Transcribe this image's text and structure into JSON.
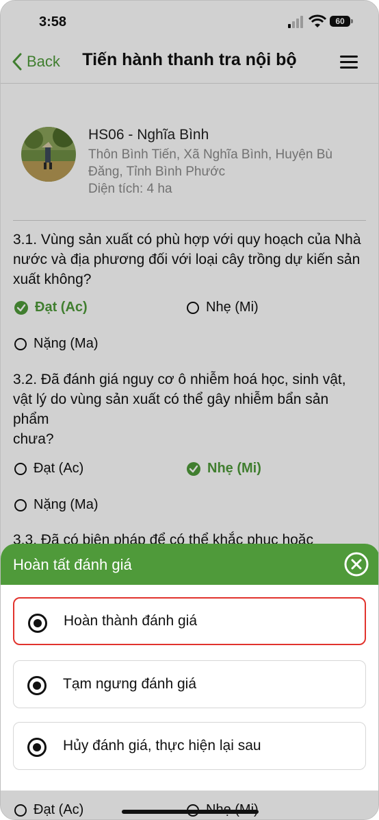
{
  "status": {
    "time": "3:58",
    "battery": "60"
  },
  "nav": {
    "back_label": "Back",
    "title": "Tiến hành thanh tra nội bộ"
  },
  "farm": {
    "name": "HS06 - Nghĩa Bình",
    "address": "Thôn Bình Tiến, Xã Nghĩa Bình, Huyện Bù Đăng, Tỉnh Bình Phước",
    "area": "Diện tích: 4 ha"
  },
  "questions": [
    {
      "text": "3.1. Vùng sản xuất có phù hợp với quy hoạch của Nhà nước và địa phương đối với loại cây trồng dự kiến sản xuất không?",
      "options": [
        "Đạt (Ac)",
        "Nhẹ (Mi)",
        "Nặng (Ma)"
      ],
      "selected": "Đạt (Ac)"
    },
    {
      "text": "3.2. Đã đánh giá nguy cơ ô nhiễm hoá học, sinh vật, vật lý do vùng sản xuất có thể gây nhiễm bẩn sản phẩm\nchưa?",
      "options": [
        "Đạt (Ac)",
        "Nhẹ (Mi)",
        "Nặng (Ma)"
      ],
      "selected": "Nhẹ (Mi)"
    },
    {
      "text": "3.3. Đã có biện pháp để có thể khắc phục hoặc",
      "options": [
        "Đạt (Ac)",
        "Nhẹ (Mi)"
      ]
    }
  ],
  "sheet": {
    "title": "Hoàn tất đánh giá",
    "choices": [
      "Hoàn thành đánh giá",
      "Tạm ngưng đánh giá",
      "Hủy đánh giá, thực hiện lại sau"
    ],
    "active_choice": "Hoàn thành đánh giá"
  },
  "colors": {
    "accent": "#4f9a3a",
    "danger": "#e1332d"
  }
}
